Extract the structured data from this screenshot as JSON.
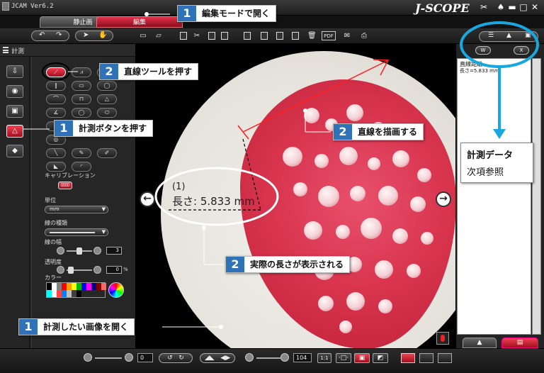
{
  "app": {
    "title": "JCAM Ver6.2",
    "brand": "J-SCOPE",
    "window_controls": [
      "✂",
      "▬",
      "□",
      "✕"
    ]
  },
  "tabs": [
    {
      "label": "静止画",
      "active": false
    },
    {
      "label": "編集",
      "active": true
    }
  ],
  "sidebar": {
    "header": "計測",
    "calibration_label": "キャリブレーション",
    "calibration_button": "ﾛﾛﾛﾛ",
    "unit_label": "単位",
    "unit_value": "mm",
    "line_type_label": "線の種類",
    "line_width_label": "線の幅",
    "line_width_value": "3",
    "opacity_label": "透明度",
    "opacity_value": "0",
    "opacity_unit": "%",
    "color_label": "カラー",
    "palette": [
      "#000000",
      "#ffffff",
      "#808080",
      "#ff0000",
      "#ffa000",
      "#ffff00",
      "#00b000",
      "#0000ff",
      "#ff00ff",
      "#000080",
      "#ff6060",
      "#00ffff"
    ]
  },
  "viewport": {
    "measure_index": "(1)",
    "measure_text": "長さ: 5.833 mm"
  },
  "right_panel": {
    "word_button": "W",
    "excel_button": "X",
    "result_title": "直線距離",
    "result_value": "長さ=5.833 mm"
  },
  "bottombar": {
    "brightness_value": "0",
    "zoom_value": "104",
    "fit_label": "1:1"
  },
  "callouts": [
    {
      "num": "1",
      "text": "編集モードで開く"
    },
    {
      "num": "2",
      "text": "直線ツールを押す"
    },
    {
      "num": "1",
      "text": "計測ボタンを押す"
    },
    {
      "num": "2",
      "text": "直線を描画する"
    },
    {
      "num": "2",
      "text": "実際の長さが表示される"
    },
    {
      "num": "1",
      "text": "計測したい画像を開く"
    }
  ],
  "info_box": {
    "line1": "計測データ",
    "line2": "次項参照"
  },
  "colors": {
    "accent_red": "#c8102e",
    "callout_blue": "#2f72b8",
    "annotation_cyan": "#19a7e0"
  }
}
